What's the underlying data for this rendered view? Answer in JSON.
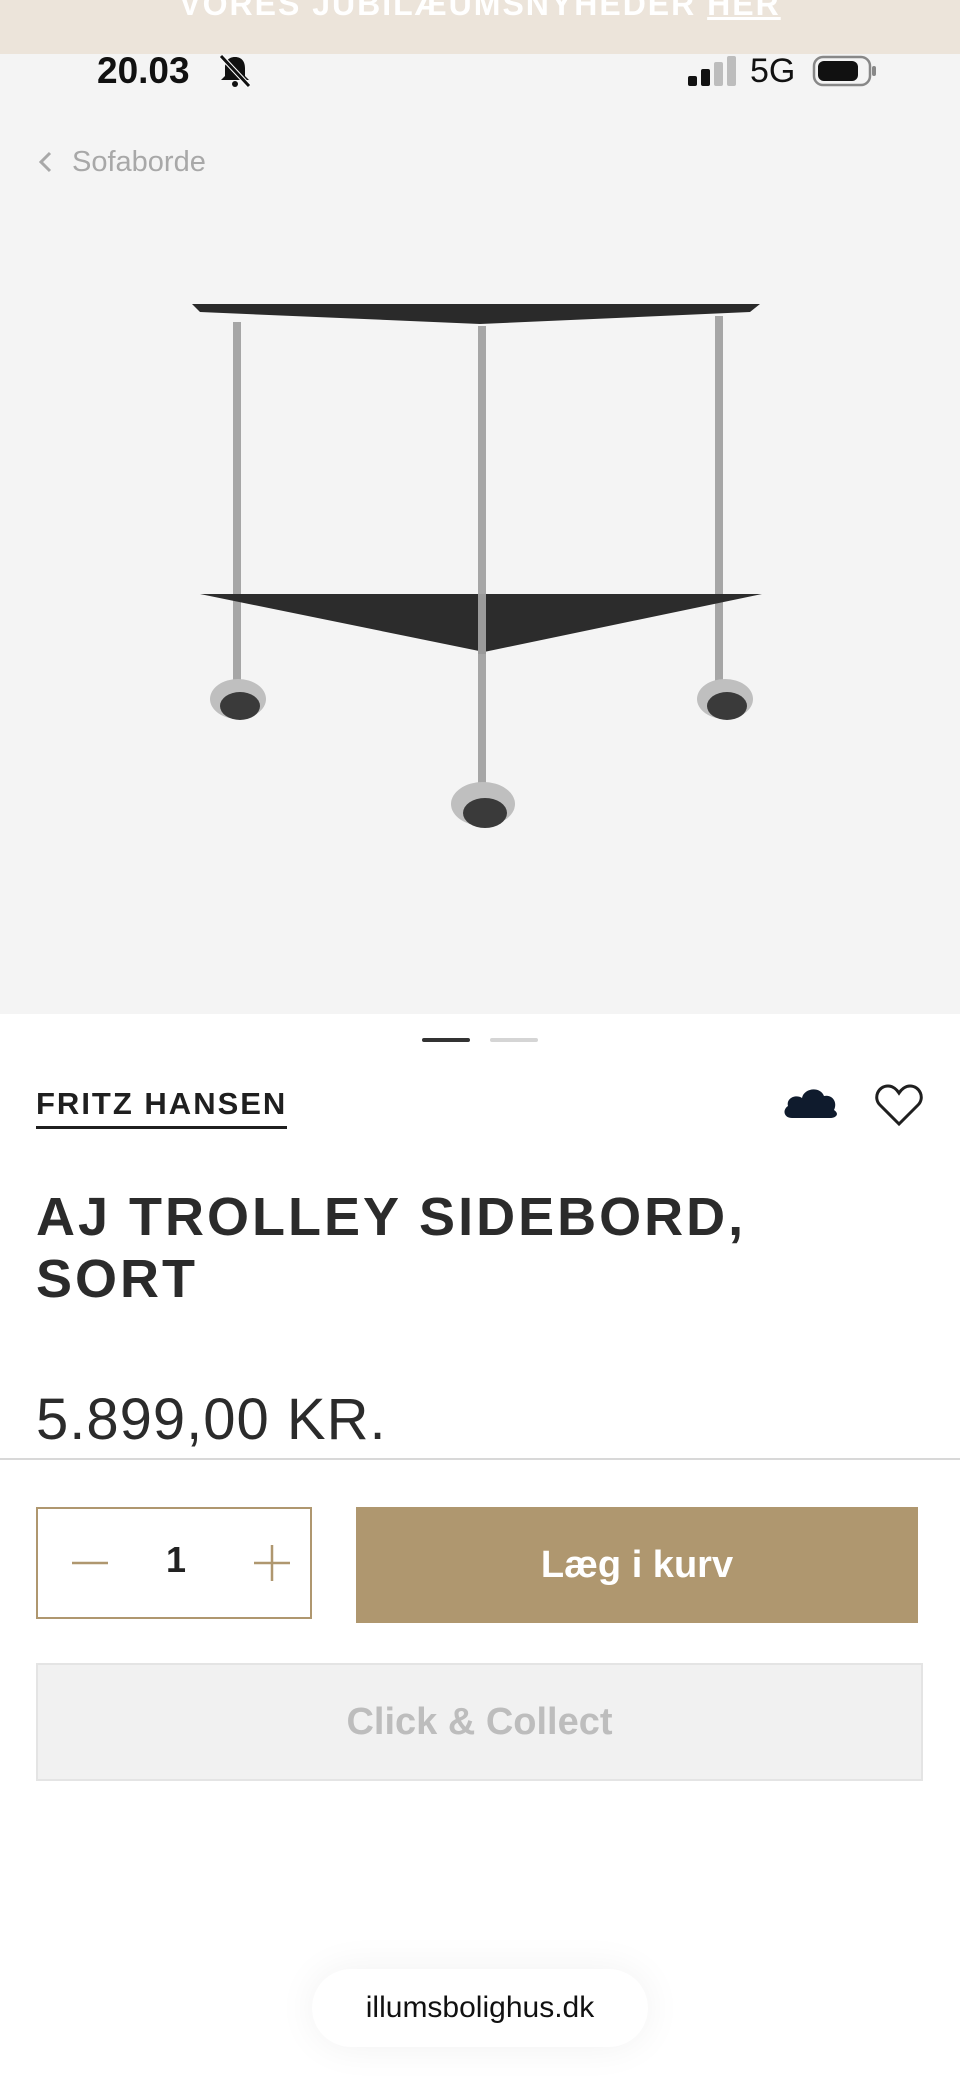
{
  "promo": {
    "text": "VORES JUBILÆUMSNYHEDER",
    "link": "HER"
  },
  "status": {
    "time": "20.03",
    "network": "5G"
  },
  "nav": {
    "back_label": "Sofaborde"
  },
  "carousel": {
    "current": 1,
    "total": 2
  },
  "product": {
    "brand": "FRITZ HANSEN",
    "title": "AJ TROLLEY SIDEBORD, SORT",
    "price": "5.899,00 KR.",
    "quantity": "1"
  },
  "actions": {
    "add_to_cart": "Læg i kurv",
    "click_collect": "Click & Collect"
  },
  "browser": {
    "url": "illumsbolighus.dk"
  },
  "colors": {
    "accent": "#af976f",
    "promo_bg": "#ece4da",
    "hero_bg": "#f4f4f4",
    "disabled_text": "#bdbdbd"
  },
  "icons": [
    "bell-slash-icon",
    "signal-icon",
    "battery-icon",
    "chevron-left-icon",
    "cloud-icon",
    "heart-icon",
    "minus-icon",
    "plus-icon"
  ]
}
